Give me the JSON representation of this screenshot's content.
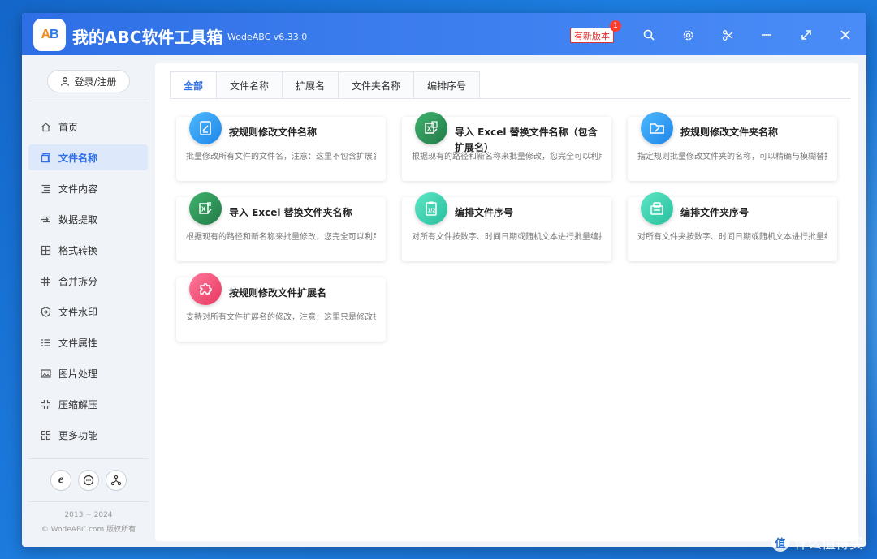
{
  "window": {
    "title": "我的ABC软件工具箱",
    "version": "WodeABC v6.33.0",
    "logo_text": "AB",
    "update_badge": "有新版本",
    "update_count": "1"
  },
  "sidebar": {
    "login_label": "登录/注册",
    "items": [
      {
        "label": "首页",
        "icon": "home-icon"
      },
      {
        "label": "文件名称",
        "icon": "file-rename-icon",
        "active": true
      },
      {
        "label": "文件内容",
        "icon": "file-content-icon"
      },
      {
        "label": "数据提取",
        "icon": "data-extract-icon"
      },
      {
        "label": "格式转换",
        "icon": "format-convert-icon"
      },
      {
        "label": "合并拆分",
        "icon": "merge-split-icon"
      },
      {
        "label": "文件水印",
        "icon": "watermark-icon"
      },
      {
        "label": "文件属性",
        "icon": "file-properties-icon"
      },
      {
        "label": "图片处理",
        "icon": "image-icon"
      },
      {
        "label": "压缩解压",
        "icon": "compress-icon"
      },
      {
        "label": "更多功能",
        "icon": "more-icon"
      }
    ],
    "copyright_years": "2013 ~ 2024",
    "copyright_text": "© WodeABC.com 版权所有"
  },
  "tabs": [
    "全部",
    "文件名称",
    "扩展名",
    "文件夹名称",
    "编排序号"
  ],
  "cards": [
    {
      "title": "按规则修改文件名称",
      "desc": "批量修改所有文件的文件名，注意：这里不包含扩展名",
      "icon": "rename-file-icon",
      "color": "#2f9bf0"
    },
    {
      "title": "导入 Excel 替换文件名称（包含扩展名）",
      "desc": "根据现有的路径和新名称来批量修改，您完全可以利用Excel",
      "icon": "excel-file-icon",
      "color": "#2e9a5a"
    },
    {
      "title": "按规则修改文件夹名称",
      "desc": "指定规则批量修改文件夹的名称，可以精确与模糊替换",
      "icon": "rename-folder-icon",
      "color": "#2f9bf0"
    },
    {
      "title": "导入 Excel 替换文件夹名称",
      "desc": "根据现有的路径和新名称来批量修改，您完全可以利用Excel",
      "icon": "excel-folder-icon",
      "color": "#2e9a5a"
    },
    {
      "title": "编排文件序号",
      "desc": "对所有文件按数字、时间日期或随机文本进行批量编排",
      "icon": "number-file-icon",
      "color": "#3fd4b4"
    },
    {
      "title": "编排文件夹序号",
      "desc": "对所有文件夹按数字、时间日期或随机文本进行批量编排",
      "icon": "number-folder-icon",
      "color": "#3fd4b4"
    },
    {
      "title": "按规则修改文件扩展名",
      "desc": "支持对所有文件扩展名的修改，注意：这里只是修改扩展名",
      "icon": "extension-icon",
      "color": "#f04e7a"
    }
  ],
  "watermark": {
    "badge": "值",
    "text": "什么值得买"
  }
}
